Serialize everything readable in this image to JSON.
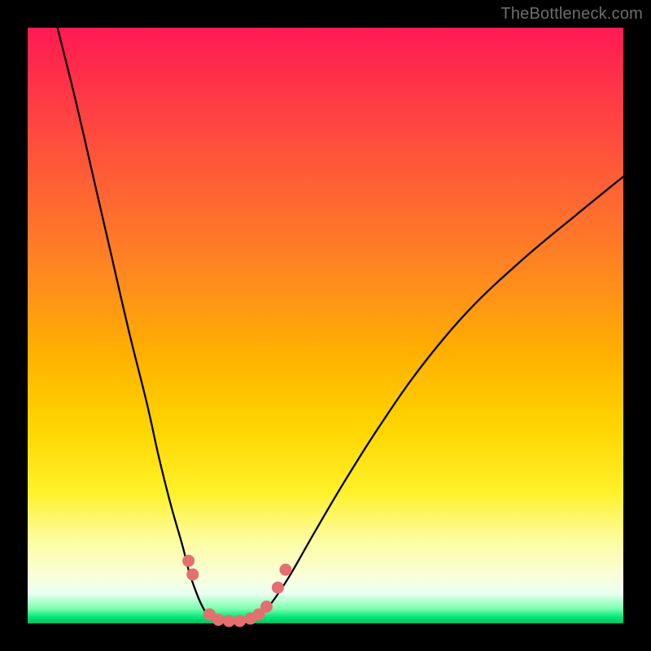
{
  "watermark": "TheBottleneck.com",
  "colors": {
    "frame": "#000000",
    "gradient_top": "#ff1a52",
    "gradient_mid": "#ffd500",
    "gradient_bottom": "#00c060",
    "curve": "#000000",
    "dots": "#e46f6f"
  },
  "chart_data": {
    "type": "line",
    "title": "",
    "xlabel": "",
    "ylabel": "",
    "xlim": [
      0,
      100
    ],
    "ylim": [
      0,
      100
    ],
    "grid": false,
    "legend": false,
    "note": "Two curves form a V-shaped bottleneck plot on a red→green heat gradient. Axes unlabeled; values are estimated positions (0–100 in plot-area coords, y=0 is top).",
    "series": [
      {
        "name": "left-curve",
        "x": [
          5,
          8,
          11,
          14,
          17,
          20,
          22,
          24,
          26,
          27,
          28,
          29,
          30,
          31
        ],
        "y": [
          0,
          12,
          25,
          38,
          51,
          63,
          72,
          80,
          87,
          91,
          94,
          96.5,
          98.3,
          99.3
        ]
      },
      {
        "name": "valley-floor",
        "x": [
          31,
          33,
          35,
          37,
          39
        ],
        "y": [
          99.3,
          99.7,
          99.7,
          99.5,
          98.8
        ]
      },
      {
        "name": "right-curve",
        "x": [
          39,
          41,
          44,
          48,
          53,
          59,
          66,
          74,
          83,
          92,
          100
        ],
        "y": [
          98.8,
          96.5,
          92,
          85,
          76.5,
          67,
          57,
          47.5,
          39,
          31.5,
          25
        ]
      }
    ],
    "markers": [
      {
        "x": 27.0,
        "y": 89.5
      },
      {
        "x": 27.7,
        "y": 91.8
      },
      {
        "x": 30.5,
        "y": 98.5
      },
      {
        "x": 32.0,
        "y": 99.4
      },
      {
        "x": 33.8,
        "y": 99.6
      },
      {
        "x": 35.6,
        "y": 99.6
      },
      {
        "x": 37.4,
        "y": 99.2
      },
      {
        "x": 38.8,
        "y": 98.5
      },
      {
        "x": 40.1,
        "y": 97.2
      },
      {
        "x": 42.0,
        "y": 94.0
      },
      {
        "x": 43.3,
        "y": 91.0
      }
    ]
  }
}
